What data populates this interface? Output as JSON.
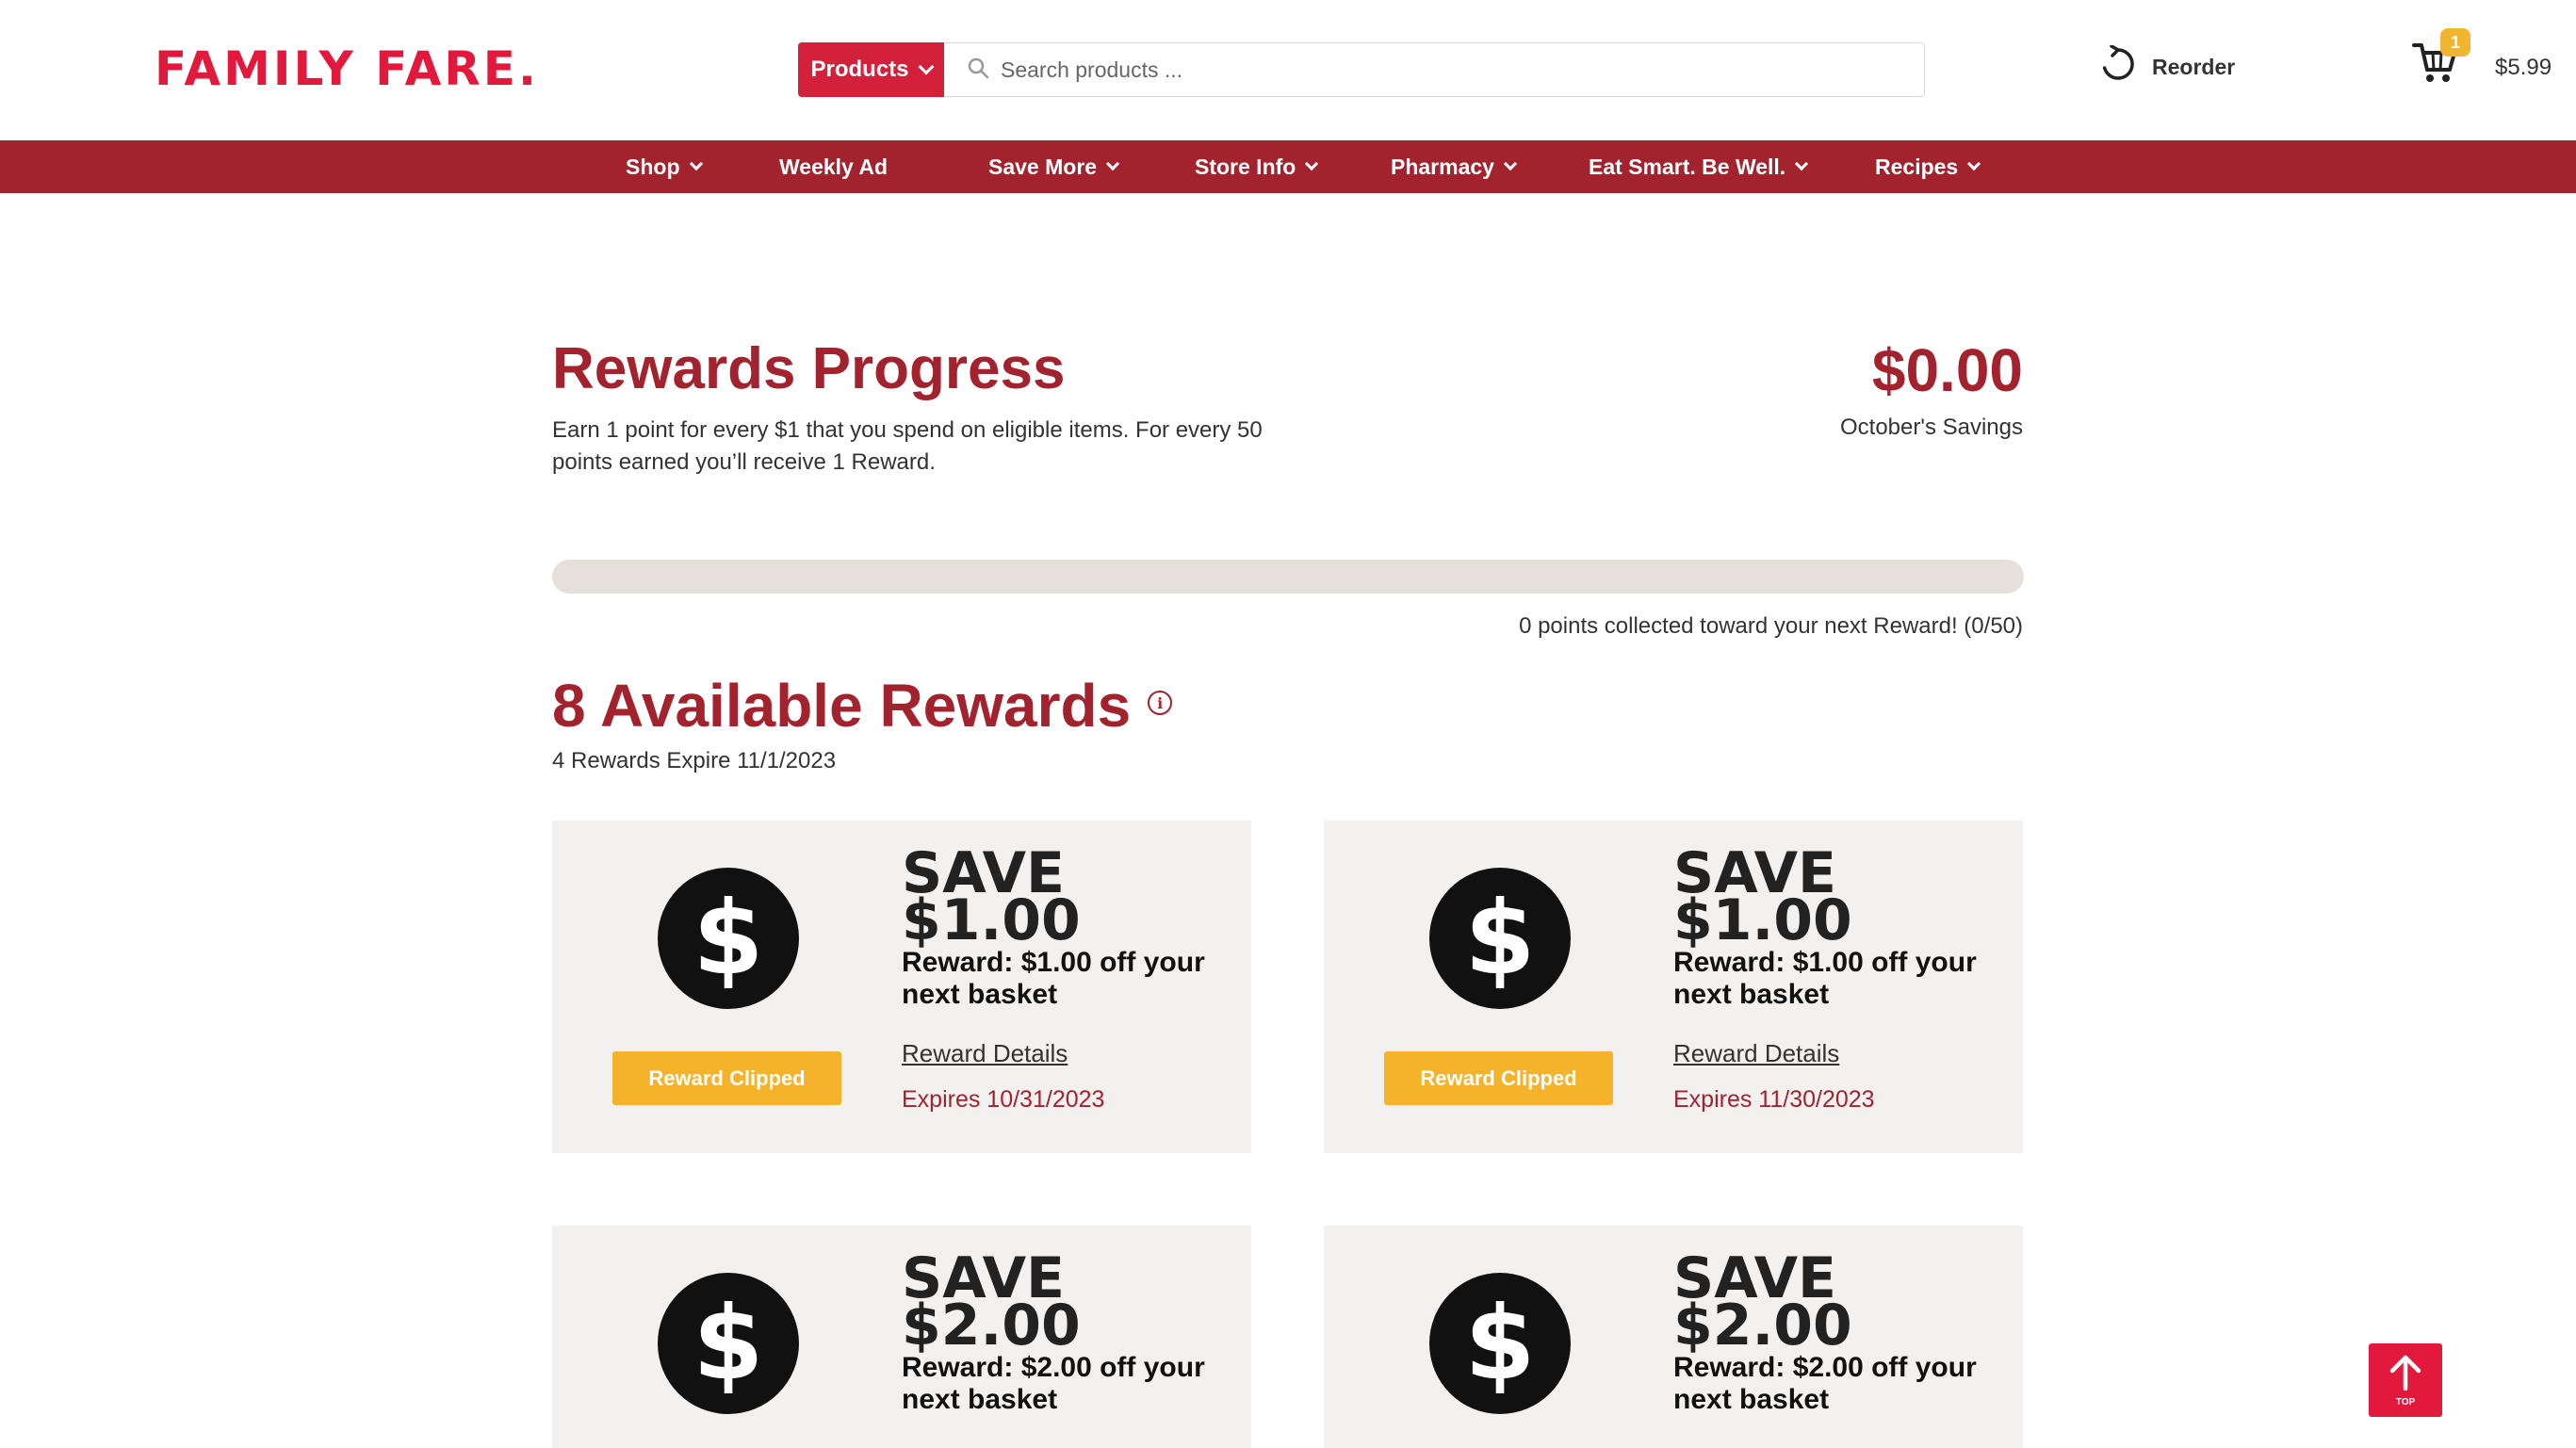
{
  "brand": {
    "name": "FAMILY FARE",
    "dot": ".",
    "color": "#e3183d"
  },
  "header": {
    "products_label": "Products",
    "search_placeholder": "Search products ...",
    "reorder_label": "Reorder",
    "cart_count": "1",
    "cart_total": "$5.99"
  },
  "nav": {
    "items": [
      {
        "label": "Shop",
        "has_dropdown": true
      },
      {
        "label": "Weekly Ad",
        "has_dropdown": false
      },
      {
        "label": "Save More",
        "has_dropdown": true
      },
      {
        "label": "Store Info",
        "has_dropdown": true
      },
      {
        "label": "Pharmacy",
        "has_dropdown": true
      },
      {
        "label": "Eat Smart. Be Well.",
        "has_dropdown": true
      },
      {
        "label": "Recipes",
        "has_dropdown": true
      }
    ]
  },
  "rewards": {
    "title": "Rewards Progress",
    "description": "Earn 1 point for every $1 that you spend on eligible items. For every 50 points earned you’ll receive 1 Reward.",
    "savings_amount": "$0.00",
    "savings_label": "October's Savings",
    "progress_fraction": 0,
    "progress_text": "0 points collected toward your next Reward! (0/50)",
    "available_title": "8 Available Rewards",
    "info_icon": "info-icon",
    "expire_note": "4 Rewards Expire 11/1/2023"
  },
  "cards": [
    {
      "save_word": "SAVE",
      "amount": "$1.00",
      "description": "Reward: $1.00 off your next basket",
      "button": "Reward Clipped",
      "details": "Reward Details",
      "expires": "Expires 10/31/2023",
      "coin_symbol": "$"
    },
    {
      "save_word": "SAVE",
      "amount": "$1.00",
      "description": "Reward: $1.00 off your next basket",
      "button": "Reward Clipped",
      "details": "Reward Details",
      "expires": "Expires 11/30/2023",
      "coin_symbol": "$"
    },
    {
      "save_word": "SAVE",
      "amount": "$2.00",
      "description": "Reward: $2.00 off your next basket",
      "coin_symbol": "$"
    },
    {
      "save_word": "SAVE",
      "amount": "$2.00",
      "description": "Reward: $2.00 off your next basket",
      "coin_symbol": "$"
    }
  ],
  "back_to_top": {
    "label": "TOP"
  },
  "colors": {
    "accent": "#a2232e",
    "brand_red": "#d3203b",
    "button_yellow": "#f5b32c",
    "card_bg": "#f3f1ef",
    "track": "#e6e0da"
  }
}
